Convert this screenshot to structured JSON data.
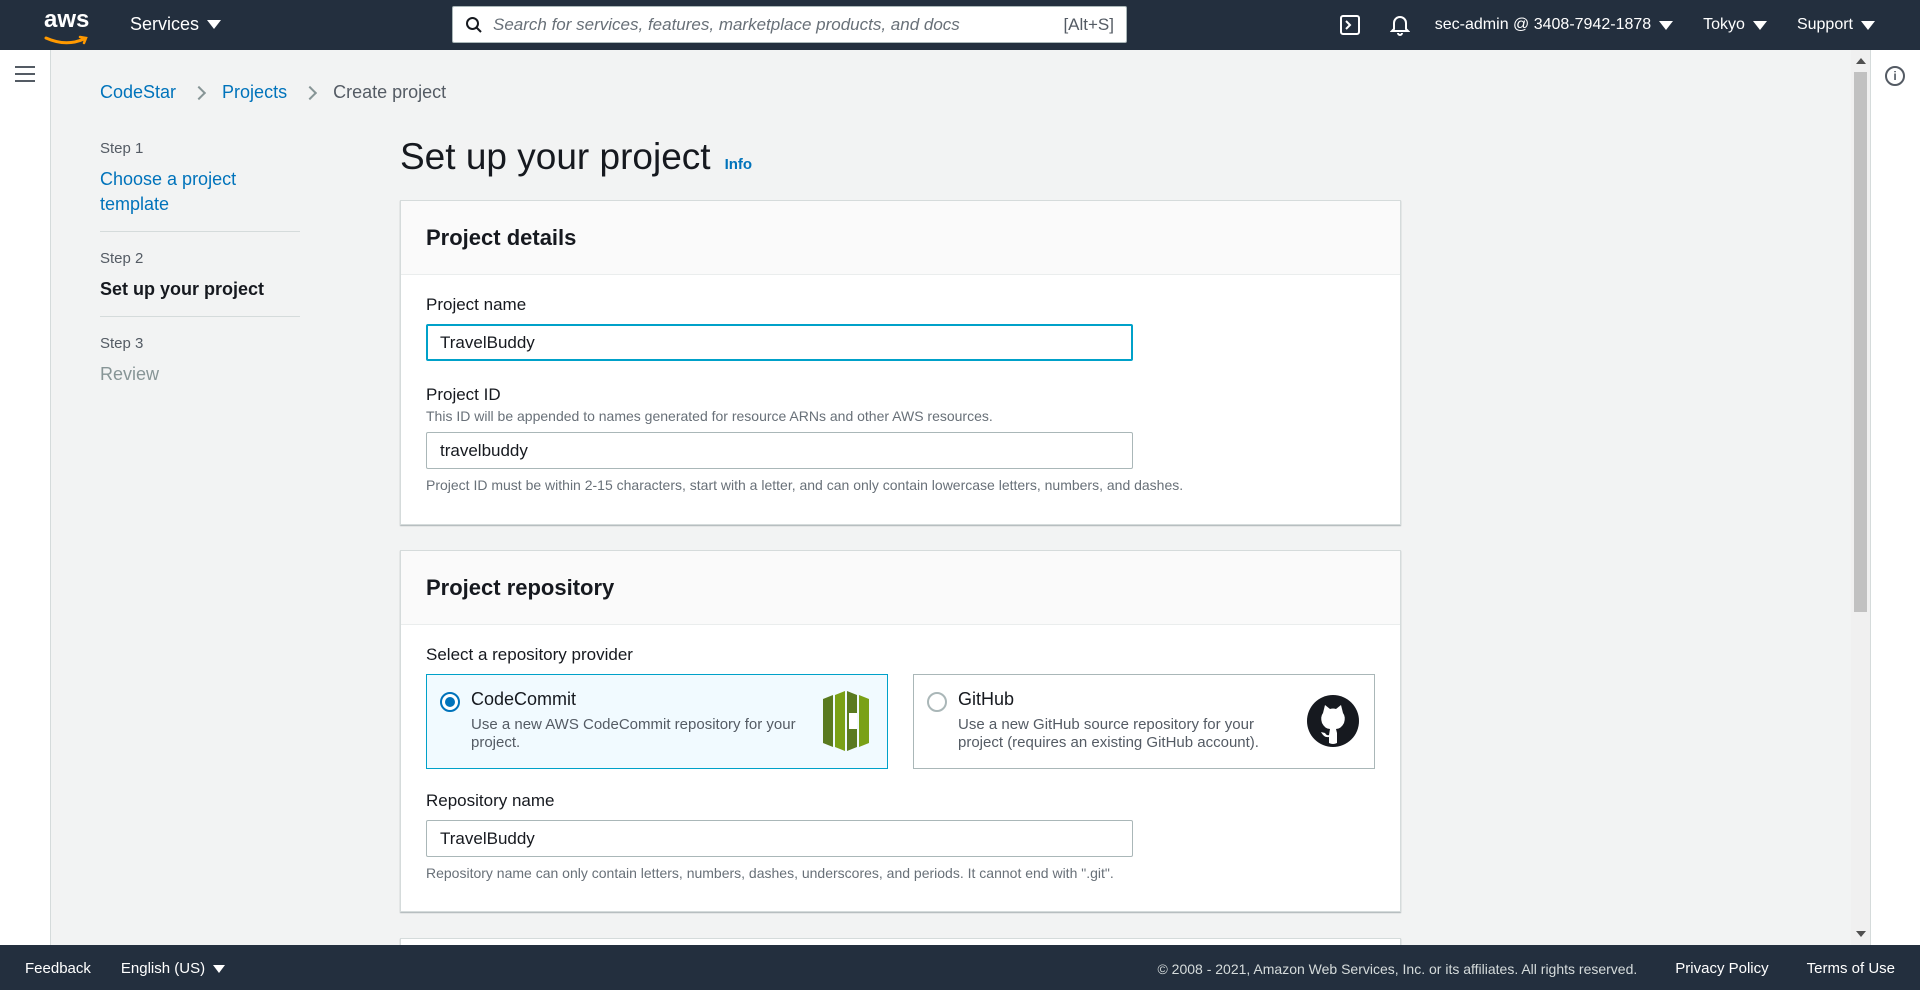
{
  "topnav": {
    "logo_text": "aws",
    "services_label": "Services",
    "search_placeholder": "Search for services, features, marketplace products, and docs",
    "search_shortcut": "[Alt+S]",
    "account_label": "sec-admin @ 3408-7942-1878",
    "region_label": "Tokyo",
    "support_label": "Support"
  },
  "breadcrumb": {
    "items": [
      "CodeStar",
      "Projects"
    ],
    "current": "Create project"
  },
  "steps": [
    {
      "num": "Step 1",
      "label": "Choose a project template"
    },
    {
      "num": "Step 2",
      "label": "Set up your project"
    },
    {
      "num": "Step 3",
      "label": "Review"
    }
  ],
  "page": {
    "title": "Set up your project",
    "info_link": "Info"
  },
  "project_details": {
    "header": "Project details",
    "name_label": "Project name",
    "name_value": "TravelBuddy",
    "id_label": "Project ID",
    "id_desc": "This ID will be appended to names generated for resource ARNs and other AWS resources.",
    "id_value": "travelbuddy",
    "id_constraint": "Project ID must be within 2-15 characters, start with a letter, and can only contain lowercase letters, numbers, and dashes."
  },
  "project_repository": {
    "header": "Project repository",
    "provider_label": "Select a repository provider",
    "providers": [
      {
        "title": "CodeCommit",
        "desc": "Use a new AWS CodeCommit repository for your project.",
        "selected": true
      },
      {
        "title": "GitHub",
        "desc": "Use a new GitHub source repository for your project (requires an existing GitHub account).",
        "selected": false
      }
    ],
    "repo_name_label": "Repository name",
    "repo_name_value": "TravelBuddy",
    "repo_constraint": "Repository name can only contain letters, numbers, dashes, underscores, and periods. It cannot end with \".git\"."
  },
  "footer": {
    "feedback": "Feedback",
    "language": "English (US)",
    "copyright": "© 2008 - 2021, Amazon Web Services, Inc. or its affiliates. All rights reserved.",
    "privacy": "Privacy Policy",
    "terms": "Terms of Use"
  },
  "colors": {
    "nav_bg": "#232f3e",
    "link": "#0073bb",
    "focus": "#00a1c9",
    "codecommit_green": "#6b8e23"
  }
}
